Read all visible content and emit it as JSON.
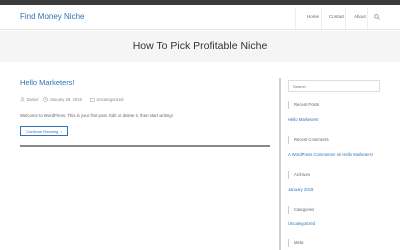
{
  "site": {
    "logo": "Find Money Niche"
  },
  "nav": [
    {
      "label": "Home"
    },
    {
      "label": "Contact"
    },
    {
      "label": "About"
    }
  ],
  "page": {
    "title": "How To Pick Profitable Niche"
  },
  "post": {
    "title": "Hello Marketers!",
    "author": "Daniel",
    "date": "January 29, 2019",
    "category": "Uncategorized",
    "excerpt": "Welcome to WordPress. This is your first post. Edit or delete it, then start writing!",
    "more_label": "Continue Reading",
    "more_arrow": "›"
  },
  "sidebar": {
    "search_placeholder": "Search",
    "recent_posts": {
      "title": "Recent Posts",
      "items": [
        "Hello Marketers!"
      ]
    },
    "recent_comments": {
      "title": "Recent Comments",
      "author": "A WordPress Commenter",
      "on": "on",
      "post": "Hello Marketers!"
    },
    "archives": {
      "title": "Archives",
      "items": [
        "January 2019"
      ]
    },
    "categories": {
      "title": "Categories",
      "items": [
        "Uncategorized"
      ]
    },
    "meta": {
      "title": "Meta"
    }
  },
  "colors": {
    "link": "#3073b8",
    "topbar": "#3a3a3a",
    "page_header_bg": "#f5f5f5"
  }
}
